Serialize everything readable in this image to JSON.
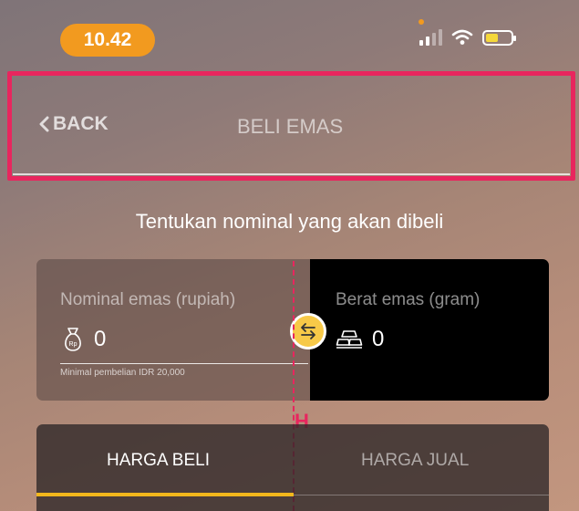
{
  "status_bar": {
    "time": "10.42",
    "signal_bars": 4,
    "signal_active": 2,
    "battery_level": 0.5
  },
  "nav": {
    "back_label": "BACK",
    "title": "BELI EMAS"
  },
  "prompt": "Tentukan nominal yang akan dibeli",
  "nominal": {
    "label": "Nominal emas (rupiah)",
    "value": "0",
    "icon": "money-bag-icon",
    "hint": "Minimal pembelian IDR 20,000"
  },
  "weight": {
    "label": "Berat emas (gram)",
    "value": "0",
    "icon": "gold-bars-icon"
  },
  "annotation": {
    "marker": "H"
  },
  "tabs": [
    {
      "label": "HARGA BELI",
      "active": true
    },
    {
      "label": "HARGA JUAL",
      "active": false
    }
  ],
  "colors": {
    "accent": "#f2b71c",
    "time_pill": "#f29a1f",
    "highlight": "#e8265e",
    "battery": "#f5d83a"
  }
}
